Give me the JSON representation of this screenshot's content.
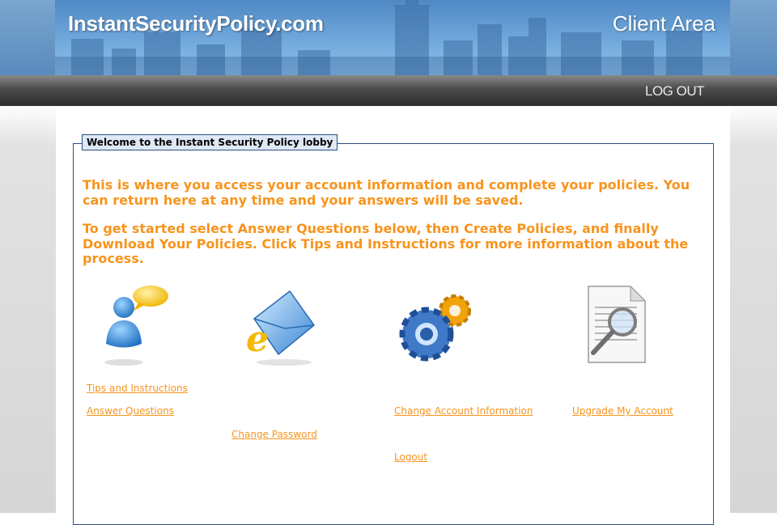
{
  "header": {
    "site_title": "InstantSecurityPolicy.com",
    "area_label": "Client Area"
  },
  "nav": {
    "logout_label": "LOG OUT"
  },
  "lobby": {
    "legend": "Welcome to the Instant Security Policy lobby",
    "intro_1": "This is where you access your account information and complete your policies. You can return here at any time and your answers will be saved.",
    "intro_2": "To get started select Answer Questions below, then Create Policies, and finally Download Your Policies.  Click Tips and Instructions for more information about the process."
  },
  "icons": {
    "tips": "person-chat-icon",
    "password": "email-envelope-icon",
    "account": "gears-icon",
    "upgrade": "document-magnifier-icon"
  },
  "links": {
    "tips": "Tips and Instructions",
    "answer": "Answer Questions",
    "password": "Change Password",
    "account": "Change Account Information",
    "logout": "Logout",
    "upgrade": "Upgrade My Account"
  },
  "colors": {
    "accent_orange": "#f7941d",
    "border_blue": "#2c4f7f",
    "banner_blue": "#5a8bbd"
  }
}
